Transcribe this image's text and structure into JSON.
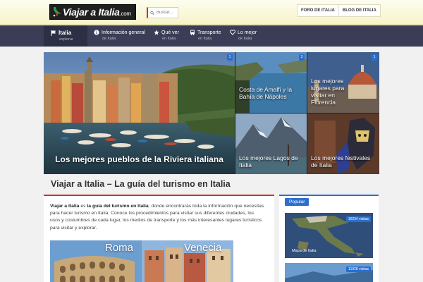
{
  "header": {
    "logo_text": "Viajar a Italia",
    "logo_domain": ".com",
    "search_placeholder": "Buscar...",
    "links": [
      "FORO DE ITALIA",
      "BLOG DE ITALIA"
    ]
  },
  "nav": [
    {
      "label": "Italia",
      "sub": "explorar",
      "icon": "flag-icon"
    },
    {
      "label": "Información general",
      "sub": "de Italia",
      "icon": "info-icon"
    },
    {
      "label": "Qué ver",
      "sub": "en Italia",
      "icon": "star-icon"
    },
    {
      "label": "Transporte",
      "sub": "en Italia",
      "icon": "bus-icon"
    },
    {
      "label": "Lo mejor",
      "sub": "de Italia",
      "icon": "heart-icon"
    }
  ],
  "mosaic": {
    "main": "Los mejores pueblos de la Riviera italiana",
    "tiles": [
      {
        "caption": "Costa de Amalfi y la Bahía de Nápoles",
        "badge": "3"
      },
      {
        "caption": "Los mejores lugares para visitar en Florencia",
        "badge": "1"
      },
      {
        "caption": "Los mejores Lagos de Italia",
        "badge": ""
      },
      {
        "caption": "Los mejores festivales de Italia",
        "badge": ""
      }
    ],
    "main_badge": "1"
  },
  "main": {
    "title": "Viajar a Italia – La guía del turismo en Italia",
    "intro_lead": "Viajar a Italia",
    "intro_mid1": " es ",
    "intro_bold": "la guía del turismo en Italia",
    "intro_rest": "; donde encontrarás toda la información que necesitas para hacer turismo en Italia. Conoce los procedimientos para visitar sus diferentes ciudades, los usos y costumbres de cada lugar, los medios de transporte y los más interesantes lugares turísticos para visitar y explorar.",
    "image_labels": [
      "Roma",
      "Venecia"
    ]
  },
  "sidebar": {
    "tab": "Popular",
    "cards": [
      {
        "views": "16234 visitas",
        "caption": "Mapa de Italia"
      },
      {
        "views": "11928 visitas",
        "caption": ""
      }
    ]
  },
  "colors": {
    "nav": "#3b3d56",
    "accent_red": "#c0392b",
    "accent_blue": "#2b6fce"
  }
}
